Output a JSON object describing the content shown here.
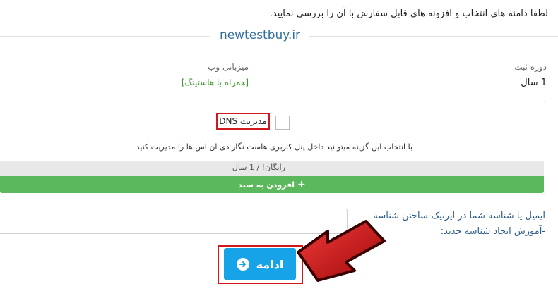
{
  "intro_text": "لطفا دامنه های انتخاب و افزونه های قابل سفارش با آن را بررسی نمایید.",
  "domain": {
    "name": "newtestbuy.ir",
    "period_label": "دوره ثبت",
    "period_value": "1 سال",
    "hosting_label": "میزبانی وب",
    "hosting_value": "[همراه با هاستینگ]"
  },
  "addon": {
    "title": "مدیریت DNS",
    "description": "با انتخاب این گزینه میتوانید داخل پنل کاربری هاست نگار دی ان اس ها را مدیریت کنید",
    "price": "رایگان! / 1 سال",
    "add_button_label": "افزودن به سبد",
    "checked": false
  },
  "email": {
    "label": "ایمیل یا شناسه شما در ایرنیک-ساختن شناسه -آموزش ایجاد شناسه جدید:",
    "value": "",
    "placeholder": ""
  },
  "continue_button": {
    "label": "ادامه"
  },
  "colors": {
    "primary_button": "#17a3e8",
    "success": "#5cb85c",
    "highlight": "#d0191e"
  }
}
